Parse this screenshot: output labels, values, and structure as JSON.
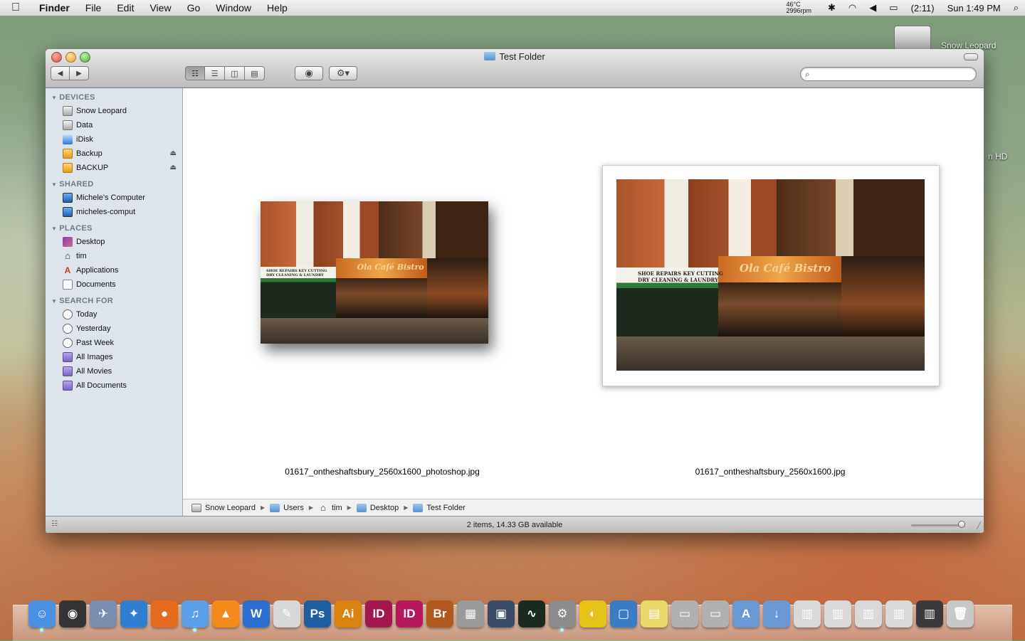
{
  "menubar": {
    "app": "Finder",
    "menus": [
      "File",
      "Edit",
      "View",
      "Go",
      "Window",
      "Help"
    ],
    "temp": "46°C",
    "fan": "2996rpm",
    "battery": "(2:11)",
    "clock": "Sun 1:49 PM"
  },
  "desktop": {
    "disk_label": "Snow Leopard",
    "disk2_label": "n HD"
  },
  "window": {
    "title": "Test Folder",
    "search_placeholder": "",
    "sidebar": {
      "devices": {
        "title": "DEVICES",
        "items": [
          "Snow Leopard",
          "Data",
          "iDisk",
          "Backup",
          "BACKUP"
        ]
      },
      "shared": {
        "title": "SHARED",
        "items": [
          "Michele's Computer",
          "micheles-comput"
        ]
      },
      "places": {
        "title": "PLACES",
        "items": [
          "Desktop",
          "tim",
          "Applications",
          "Documents"
        ]
      },
      "search_for": {
        "title": "SEARCH FOR",
        "items": [
          "Today",
          "Yesterday",
          "Past Week",
          "All Images",
          "All Movies",
          "All Documents"
        ]
      }
    },
    "files": [
      {
        "name": "01617_ontheshaftsbury_2560x1600_photoshop.jpg",
        "sign": "Ola Café Bistro",
        "sign2": "SHOE REPAIRS KEY CUTTING DRY CLEANING & LAUNDRY"
      },
      {
        "name": "01617_ontheshaftsbury_2560x1600.jpg",
        "sign": "Ola Café Bistro",
        "sign2": "SHOE REPAIRS KEY CUTTING DRY CLEANING & LAUNDRY"
      }
    ],
    "path": [
      "Snow Leopard",
      "Users",
      "tim",
      "Desktop",
      "Test Folder"
    ],
    "status": "2 items, 14.33 GB available"
  },
  "dock": {
    "items": [
      {
        "name": "Finder",
        "label": "☺",
        "color": "#4a90e0"
      },
      {
        "name": "Dashboard",
        "label": "◉",
        "color": "#333333"
      },
      {
        "name": "Mail",
        "label": "✈",
        "color": "#7a8fb0"
      },
      {
        "name": "Safari",
        "label": "✦",
        "color": "#2f7fd3"
      },
      {
        "name": "Firefox",
        "label": "●",
        "color": "#e56b1f"
      },
      {
        "name": "iTunes",
        "label": "♫",
        "color": "#5aa0e8"
      },
      {
        "name": "VLC",
        "label": "▲",
        "color": "#f28a1c"
      },
      {
        "name": "Word",
        "label": "W",
        "color": "#2a6fd0"
      },
      {
        "name": "TextEdit",
        "label": "✎",
        "color": "#d8d8d8"
      },
      {
        "name": "Photoshop",
        "label": "Ps",
        "color": "#1d5fa0"
      },
      {
        "name": "Illustrator",
        "label": "Ai",
        "color": "#d9820f"
      },
      {
        "name": "InDesign",
        "label": "ID",
        "color": "#a3174e"
      },
      {
        "name": "InDesign2",
        "label": "ID",
        "color": "#b5195d"
      },
      {
        "name": "Bridge",
        "label": "Br",
        "color": "#b3581c"
      },
      {
        "name": "Calculator",
        "label": "▦",
        "color": "#9a9a9a"
      },
      {
        "name": "Spaces",
        "label": "▣",
        "color": "#3b4a66"
      },
      {
        "name": "Activity Monitor",
        "label": "∿",
        "color": "#1b2b22"
      },
      {
        "name": "System Preferences",
        "label": "⚙",
        "color": "#8c8c8c"
      },
      {
        "name": "Cyberduck",
        "label": "◐",
        "color": "#e6c21a"
      },
      {
        "name": "VirtualBox",
        "label": "▢",
        "color": "#3a7cc6"
      },
      {
        "name": "Stickies",
        "label": "▤",
        "color": "#e8d96a"
      },
      {
        "name": "Disk1",
        "label": "▭",
        "color": "#b0b0b0"
      },
      {
        "name": "Disk2",
        "label": "▭",
        "color": "#b0b0b0"
      },
      {
        "name": "Applications Folder",
        "label": "A",
        "color": "#6a9ad6"
      },
      {
        "name": "Downloads Folder",
        "label": "↓",
        "color": "#6a9ad6"
      },
      {
        "name": "Window1",
        "label": "▥",
        "color": "#d9d9d9"
      },
      {
        "name": "Window2",
        "label": "▥",
        "color": "#d9d9d9"
      },
      {
        "name": "Window3",
        "label": "▥",
        "color": "#d9d9d9"
      },
      {
        "name": "Window4",
        "label": "▥",
        "color": "#d9d9d9"
      },
      {
        "name": "Window5",
        "label": "▥",
        "color": "#3a3a3a"
      },
      {
        "name": "Trash",
        "label": "🗑",
        "color": "#c8c8c8"
      }
    ]
  }
}
